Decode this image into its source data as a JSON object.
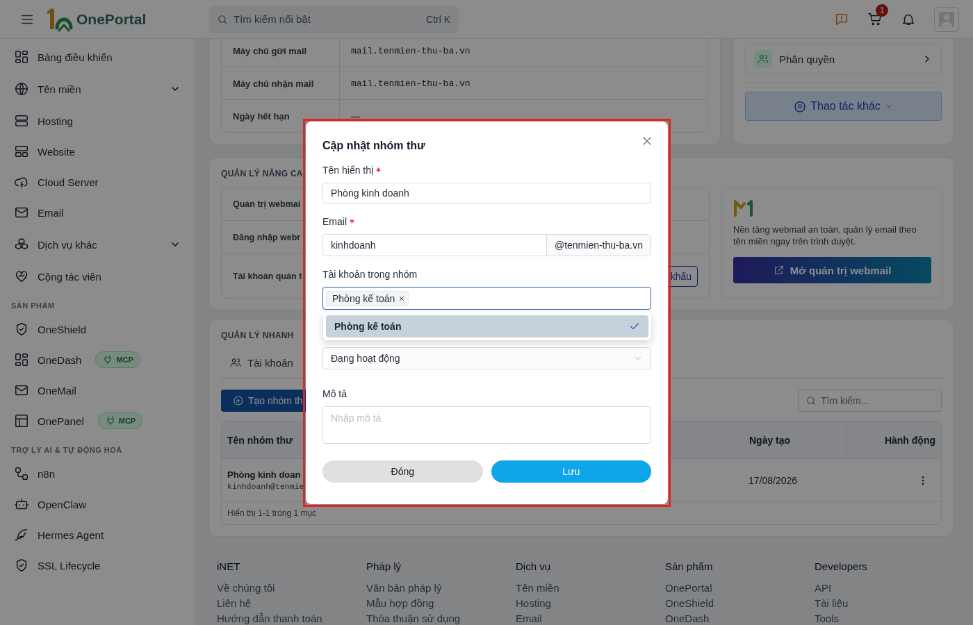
{
  "header": {
    "logo_text": "OnePortal",
    "search": {
      "placeholder": "Tìm kiếm nổi bật",
      "shortcut": "Ctrl K"
    },
    "cart_count": "1"
  },
  "sidebar": {
    "sections": [
      {
        "items": [
          {
            "label": "Bảng điều khiển",
            "expandable": false
          },
          {
            "label": "Tên miền",
            "expandable": true
          },
          {
            "label": "Hosting",
            "expandable": false
          },
          {
            "label": "Website",
            "expandable": false
          },
          {
            "label": "Cloud Server",
            "expandable": false
          },
          {
            "label": "Email",
            "expandable": false
          },
          {
            "label": "Dịch vụ khác",
            "expandable": true
          },
          {
            "label": "Cộng tác viên",
            "expandable": false
          }
        ]
      },
      {
        "title": "SẢN PHẨM",
        "items": [
          {
            "label": "OneShield",
            "expandable": false
          },
          {
            "label": "OneDash",
            "expandable": false,
            "badge": "MCP"
          },
          {
            "label": "OneMail",
            "expandable": false
          },
          {
            "label": "OnePanel",
            "expandable": false,
            "badge": "MCP"
          }
        ]
      },
      {
        "title": "TRỢ LÝ AI & TỰ ĐỘNG HOÁ",
        "items": [
          {
            "label": "n8n",
            "expandable": false
          },
          {
            "label": "OpenClaw",
            "expandable": false
          },
          {
            "label": "Hermes Agent",
            "expandable": false
          },
          {
            "label": "SSL Lifecycle",
            "expandable": false
          }
        ]
      }
    ]
  },
  "server_info": {
    "rows": [
      {
        "label": "Máy chủ gửi mail",
        "value": "mail.tenmien-thu-ba.vn",
        "kind": "text"
      },
      {
        "label": "Máy chủ nhận mail",
        "value": "mail.tenmien-thu-ba.vn",
        "kind": "text"
      },
      {
        "label": "Ngày hết hạn",
        "value": "—",
        "kind": "empty"
      }
    ]
  },
  "side_actions": {
    "permission": "Phân quyền",
    "more_button": "Thao tác khác"
  },
  "advanced": {
    "title": "QUẢN LÝ NÂNG CA",
    "rows": [
      "Quản trị webmai",
      "Đăng nhập webr",
      "Tài khoản quản t"
    ],
    "button": "khẩu"
  },
  "webmail_promo": {
    "description": "Nền tảng webmail an toàn, quản lý email theo tên miền ngay trên trình duyệt.",
    "button": "Mở quản trị webmail"
  },
  "quick": {
    "title": "QUẢN LÝ NHANH",
    "tabs": [
      {
        "label": "Tài khoản",
        "selected": false
      }
    ],
    "create_button": "Tạo nhóm th",
    "search": {
      "placeholder": "Tìm kiếm..."
    },
    "table": {
      "columns": [
        "Tên nhóm thư",
        "Ngày tạo",
        "Hành động"
      ],
      "rows": [
        {
          "name": "Phòng kinh doan",
          "email": "kinhdoanh@tenmie",
          "created": "17/08/2026"
        }
      ]
    },
    "summary": "Hiển thị 1-1 trong 1 mục"
  },
  "footer": {
    "columns": [
      {
        "title": "iNET",
        "links": [
          "Về chúng tôi",
          "Liên hệ",
          "Hướng dẫn thanh toán"
        ]
      },
      {
        "title": "Pháp lý",
        "links": [
          "Văn bản pháp lý",
          "Mẫu hợp đồng",
          "Thỏa thuận sử dụng"
        ]
      },
      {
        "title": "Dịch vụ",
        "links": [
          "Tên miền",
          "Hosting",
          "Email"
        ]
      },
      {
        "title": "Sản phẩm",
        "links": [
          "OnePortal",
          "OneShield",
          "OneDash"
        ]
      },
      {
        "title": "Developers",
        "links": [
          "API",
          "Tài liệu",
          "Tools"
        ]
      }
    ]
  },
  "modal": {
    "title": "Cập nhật nhóm thư",
    "name_field": {
      "label": "Tên hiển thị",
      "required": true,
      "value": "Phòng kinh doanh"
    },
    "email_field": {
      "label": "Email",
      "required": true,
      "value": "kinhdoanh",
      "suffix": "@tenmien-thu-ba.vn"
    },
    "members_field": {
      "label": "Tài khoản trong nhóm",
      "tags": [
        "Phòng kế toán"
      ],
      "options": [
        {
          "label": "Phòng kế toán",
          "selected": true
        }
      ]
    },
    "status_select": {
      "value": "Đang hoạt động"
    },
    "description_field": {
      "label": "Mô tả",
      "placeholder": "Nhập mô tả"
    },
    "buttons": {
      "cancel": "Đóng",
      "save": "Lưu"
    }
  }
}
